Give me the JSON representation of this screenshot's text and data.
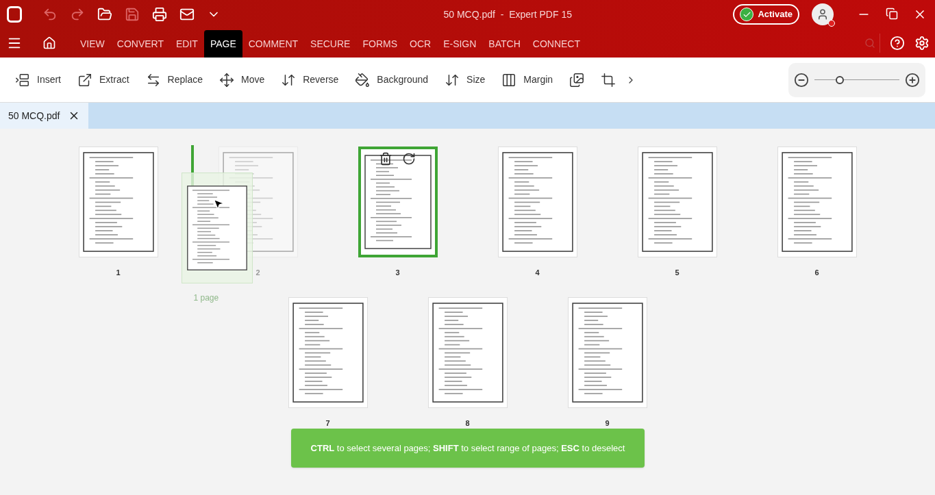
{
  "window": {
    "title": "50 MCQ.pdf  -  Expert PDF 15",
    "activate": "Activate"
  },
  "menu_tabs": [
    {
      "label": "VIEW",
      "selected": false
    },
    {
      "label": "CONVERT",
      "selected": false
    },
    {
      "label": "EDIT",
      "selected": false
    },
    {
      "label": "PAGE",
      "selected": true
    },
    {
      "label": "COMMENT",
      "selected": false
    },
    {
      "label": "SECURE",
      "selected": false
    },
    {
      "label": "FORMS",
      "selected": false
    },
    {
      "label": "OCR",
      "selected": false
    },
    {
      "label": "E-SIGN",
      "selected": false
    },
    {
      "label": "BATCH",
      "selected": false
    },
    {
      "label": "CONNECT",
      "selected": false
    }
  ],
  "toolbar": [
    {
      "kind": "insert",
      "label": "Insert"
    },
    {
      "kind": "extract",
      "label": "Extract"
    },
    {
      "kind": "replace",
      "label": "Replace"
    },
    {
      "kind": "move",
      "label": "Move"
    },
    {
      "kind": "reverse",
      "label": "Reverse"
    },
    {
      "kind": "background",
      "label": "Background"
    },
    {
      "kind": "size",
      "label": "Size"
    },
    {
      "kind": "margin",
      "label": "Margin"
    },
    {
      "kind": "image"
    },
    {
      "kind": "crop"
    }
  ],
  "zoom": {
    "level": 0.3
  },
  "document_tabs": [
    {
      "label": "50 MCQ.pdf",
      "selected": true
    }
  ],
  "pages": [
    {
      "number": "1",
      "selected": false,
      "dragging": false
    },
    {
      "number": "2",
      "selected": false,
      "dragging": true
    },
    {
      "number": "3",
      "selected": true,
      "dragging": false
    },
    {
      "number": "4",
      "selected": false,
      "dragging": false
    },
    {
      "number": "5",
      "selected": false,
      "dragging": false
    },
    {
      "number": "6",
      "selected": false,
      "dragging": false
    },
    {
      "number": "7",
      "selected": false,
      "dragging": false
    },
    {
      "number": "8",
      "selected": false,
      "dragging": false
    },
    {
      "number": "9",
      "selected": false,
      "dragging": false
    }
  ],
  "drag_label": "1 page",
  "hint": "**CTRL** to select several pages; **SHIFT** to select range of pages; **ESC** to deselect"
}
